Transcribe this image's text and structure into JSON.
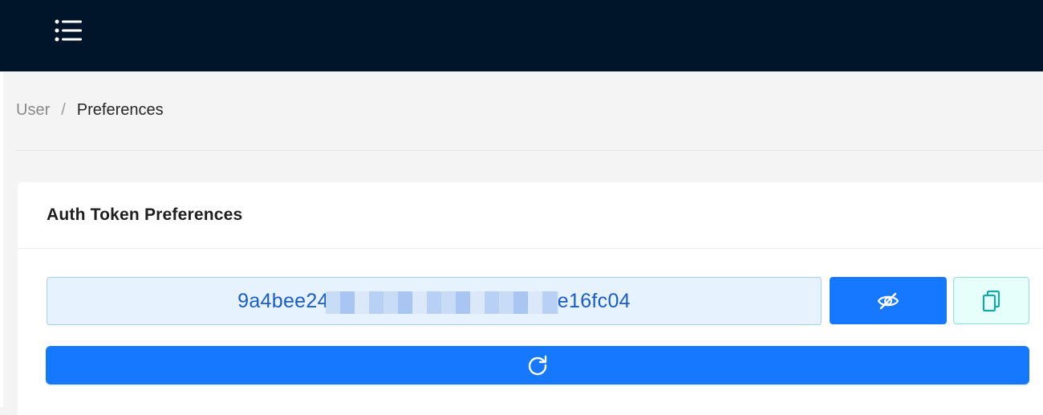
{
  "header": {
    "menu_icon": "menu-list-icon",
    "background": "#00152a"
  },
  "breadcrumb": {
    "items": [
      "User",
      "Preferences"
    ],
    "separator": "/"
  },
  "card": {
    "title": "Auth Token Preferences",
    "token": {
      "prefix": "9a4bee24",
      "suffix": "e16fc04"
    },
    "buttons": {
      "visibility_icon": "eye-slash-icon",
      "copy_icon": "copy-icon",
      "refresh_icon": "refresh-icon"
    }
  },
  "colors": {
    "primary": "#1677ff",
    "token_bg": "#e6f3ff",
    "token_text": "#1a5ccc",
    "copy_bg": "#e6fffb",
    "copy_icon": "#13a8a8"
  }
}
